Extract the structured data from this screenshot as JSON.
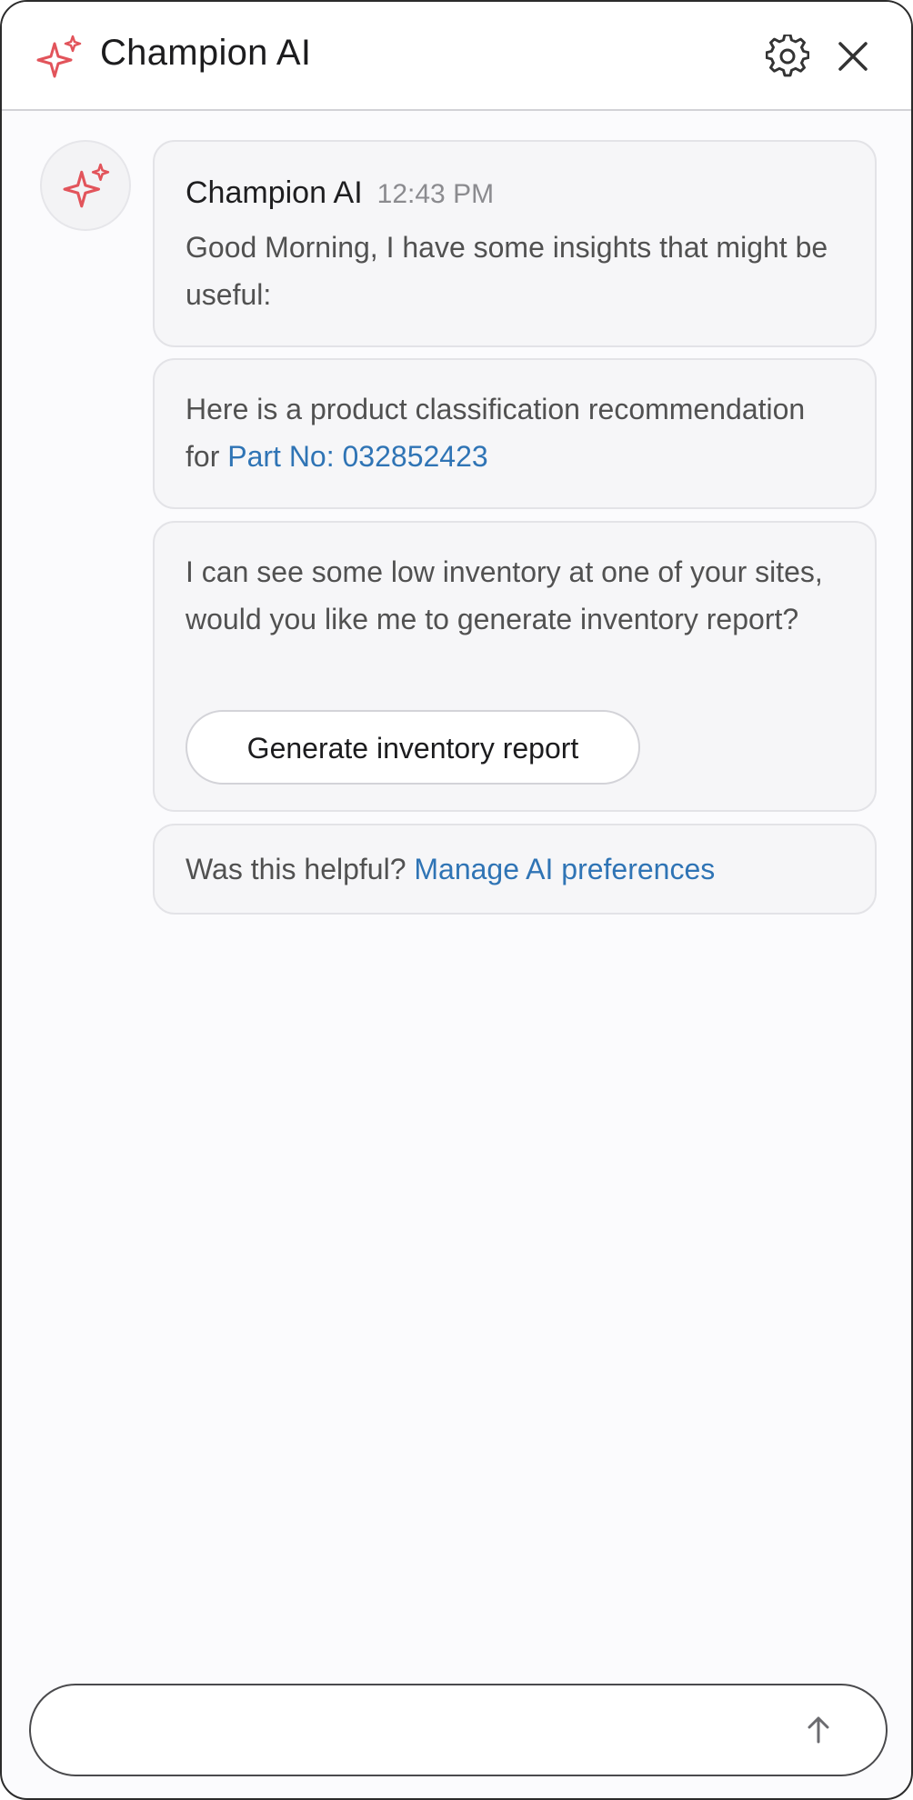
{
  "header": {
    "title": "Champion AI",
    "icons": {
      "brand": "sparkle-icon",
      "settings": "gear-icon",
      "close": "close-icon"
    }
  },
  "colors": {
    "accent": "#e2545b",
    "link": "#2f74b5",
    "card_bg": "#f6f6f8"
  },
  "messages": [
    {
      "sender": "Champion AI",
      "time": "12:43 PM",
      "text": "Good Morning, I have some insights that might be useful:"
    },
    {
      "text_before": "Here is a product classification recommendation for",
      "link_label": "Part No: 032852423"
    },
    {
      "text": "I can see some low inventory at one of your sites, would you like me to generate inventory report?",
      "button_label": "Generate inventory report"
    },
    {
      "text_before": "Was this helpful?",
      "link_label": "Manage AI preferences"
    }
  ],
  "composer": {
    "placeholder": "",
    "value": "",
    "send_icon": "arrow-up-icon"
  }
}
